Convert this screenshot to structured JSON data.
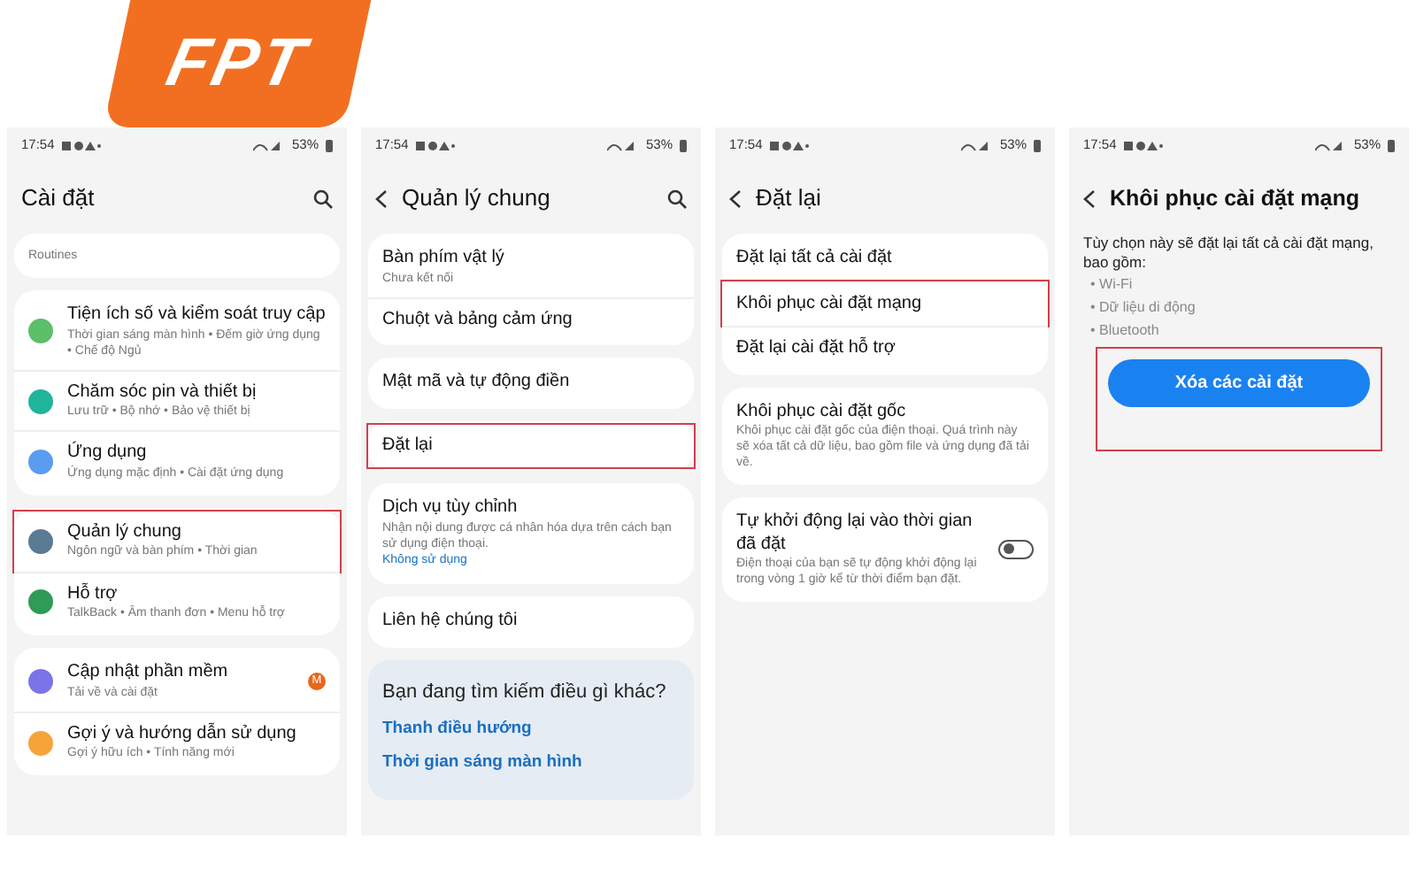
{
  "logo": {
    "text": "FPT"
  },
  "screens": [
    {
      "status_bar": {
        "time": "17:54",
        "battery": "53%"
      },
      "title": "Cài đặt",
      "back": false,
      "search": true,
      "groups": [
        [
          {
            "kind": "cut",
            "subtitle": "Routines",
            "highlighted": false
          }
        ],
        [
          {
            "kind": "setting",
            "title": "Tiện ích số và kiểm soát truy cập",
            "subtitle": "Thời gian sáng màn hình • Đếm giờ ứng dụng • Chế độ Ngủ",
            "color": "#5cbf6a",
            "highlighted": false
          },
          {
            "kind": "setting",
            "title": "Chăm sóc pin và thiết bị",
            "subtitle": "Lưu trữ • Bộ nhớ • Bảo vệ thiết bị",
            "color": "#1fb59b",
            "highlighted": false
          },
          {
            "kind": "setting",
            "title": "Ứng dụng",
            "subtitle": "Ứng dụng mặc định • Cài đặt ứng dụng",
            "color": "#5a9cf0",
            "highlighted": false
          }
        ],
        [
          {
            "kind": "setting",
            "title": "Quản lý chung",
            "subtitle": "Ngôn ngữ và bàn phím • Thời gian",
            "color": "#5b7a94",
            "highlighted": true
          },
          {
            "kind": "setting",
            "title": "Hỗ trợ",
            "subtitle": "TalkBack • Âm thanh đơn • Menu hỗ trợ",
            "color": "#2e9b57",
            "highlighted": false
          }
        ],
        [
          {
            "kind": "setting",
            "title": "Cập nhật phần mềm",
            "subtitle": "Tải về và cài đặt",
            "color": "#7b73e8",
            "badge": "M",
            "highlighted": false
          },
          {
            "kind": "setting",
            "title": "Gợi ý và hướng dẫn sử dụng",
            "subtitle": "Gợi ý hữu ích • Tính năng mới",
            "color": "#f5a43a",
            "highlighted": false
          }
        ]
      ]
    },
    {
      "status_bar": {
        "time": "17:54",
        "battery": "53%"
      },
      "title": "Quản lý chung",
      "back": true,
      "search": true,
      "groups": [
        [
          {
            "kind": "plain",
            "title": "Bàn phím vật lý",
            "subtitle": "Chưa kết nối",
            "highlighted": false
          },
          {
            "kind": "plain",
            "title": "Chuột và bảng cảm ứng",
            "highlighted": false
          }
        ],
        [
          {
            "kind": "plain",
            "title": "Mật mã và tự động điền",
            "highlighted": false
          }
        ],
        [
          {
            "kind": "plain",
            "title": "Đặt lại",
            "highlighted": true
          }
        ],
        [
          {
            "kind": "plain",
            "title": "Dịch vụ tùy chỉnh",
            "subtitle": "Nhận nội dung được cá nhân hóa dựa trên cách bạn sử dụng điện thoại.",
            "link": "Không sử dụng",
            "highlighted": false
          }
        ],
        [
          {
            "kind": "plain",
            "title": "Liên hệ chúng tôi",
            "highlighted": false
          }
        ]
      ],
      "suggestions": {
        "title": "Bạn đang tìm kiếm điều gì khác?",
        "links": [
          "Thanh điều hướng",
          "Thời gian sáng màn hình"
        ]
      }
    },
    {
      "status_bar": {
        "time": "17:54",
        "battery": "53%"
      },
      "title": "Đặt lại",
      "back": true,
      "search": false,
      "groups": [
        [
          {
            "kind": "plain",
            "title": "Đặt lại tất cả cài đặt",
            "highlighted": false
          },
          {
            "kind": "plain",
            "title": "Khôi phục cài đặt mạng",
            "highlighted": true
          },
          {
            "kind": "plain",
            "title": "Đặt lại cài đặt hỗ trợ",
            "highlighted": false
          }
        ],
        [
          {
            "kind": "plain",
            "title": "Khôi phục cài đặt gốc",
            "subtitle": "Khôi phục cài đặt gốc của điện thoại. Quá trình này sẽ xóa tất cả dữ liệu, bao gồm file và ứng dụng đã tải về.",
            "highlighted": false
          }
        ],
        [
          {
            "kind": "toggle",
            "title": "Tự khởi động lại vào thời gian đã đặt",
            "subtitle": "Điện thoại của bạn sẽ tự động khởi động lại trong vòng 1 giờ kể từ thời điểm bạn đặt.",
            "on": false,
            "highlighted": false
          }
        ]
      ]
    },
    {
      "status_bar": {
        "time": "17:54",
        "battery": "53%"
      },
      "title": "Khôi phục cài đặt mạng",
      "back": true,
      "search": false,
      "description": "Tùy chọn này sẽ đặt lại tất cả cài đặt mạng, bao gồm:",
      "bullets": [
        "• Wi-Fi",
        "• Dữ liệu di động",
        "• Bluetooth"
      ],
      "button": {
        "label": "Xóa các cài đặt",
        "highlighted": true
      }
    }
  ]
}
